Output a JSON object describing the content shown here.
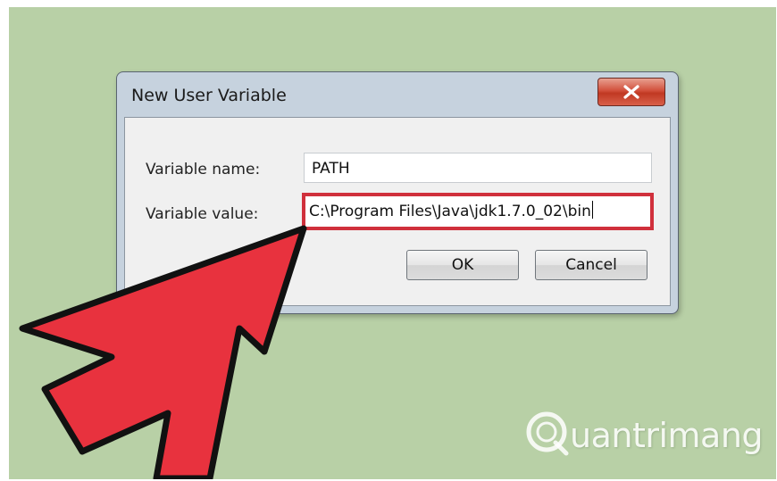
{
  "dialog": {
    "title": "New User Variable",
    "close_icon": "close-icon",
    "name_label": "Variable name:",
    "name_value": "PATH",
    "value_label": "Variable value:",
    "value_value": "C:\\Program Files\\Java\\jdk1.7.0_02\\bin",
    "ok_label": "OK",
    "cancel_label": "Cancel"
  },
  "annotation": {
    "pointer_icon": "arrow-pointer-icon",
    "highlight_color": "#d0303c",
    "arrow_color": "#e8323e"
  },
  "watermark": {
    "logo_icon": "quantrimang-logo-icon",
    "text": "uantrimang"
  },
  "colors": {
    "background": "#b8d0a6",
    "dialog_frame": "#c6d2de",
    "client_area": "#f0f0f0"
  }
}
